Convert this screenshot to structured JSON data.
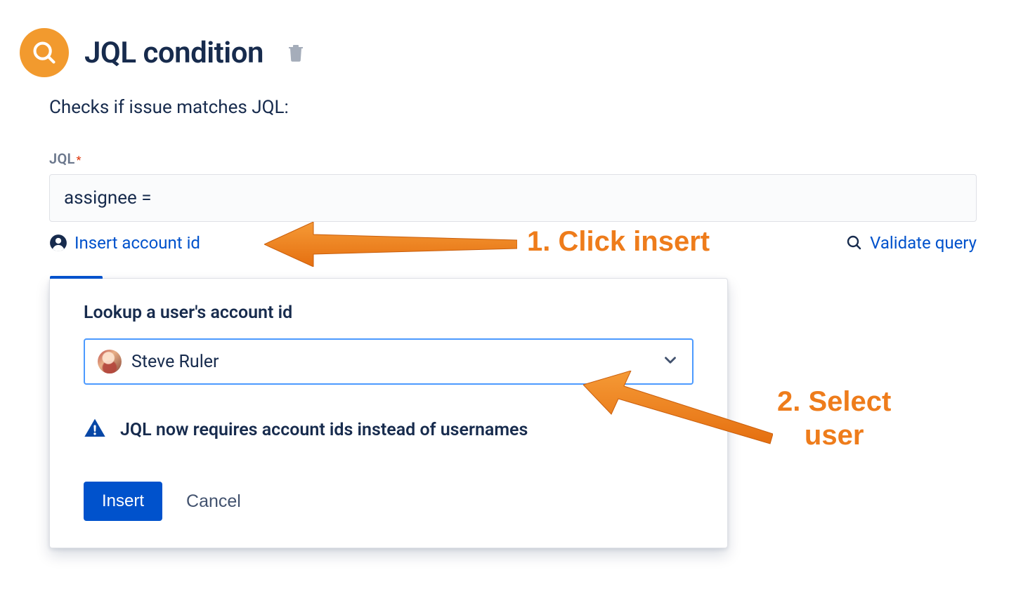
{
  "header": {
    "title": "JQL condition",
    "subtitle": "Checks if issue matches JQL:"
  },
  "form": {
    "jql_label": "JQL",
    "jql_value": "assignee ="
  },
  "links": {
    "insert_account_id": "Insert account id",
    "validate_query": "Validate query"
  },
  "popup": {
    "title": "Lookup a user's account id",
    "selected_user": "Steve Ruler",
    "info_text": "JQL now requires account ids instead of usernames",
    "insert_btn": "Insert",
    "cancel_btn": "Cancel"
  },
  "annotations": {
    "step1": "1. Click insert",
    "step2_line1": "2. Select",
    "step2_line2": "user"
  },
  "colors": {
    "accent_orange": "#F29A2E",
    "link_blue": "#0052CC",
    "annotation_orange": "#EE7C1B"
  }
}
